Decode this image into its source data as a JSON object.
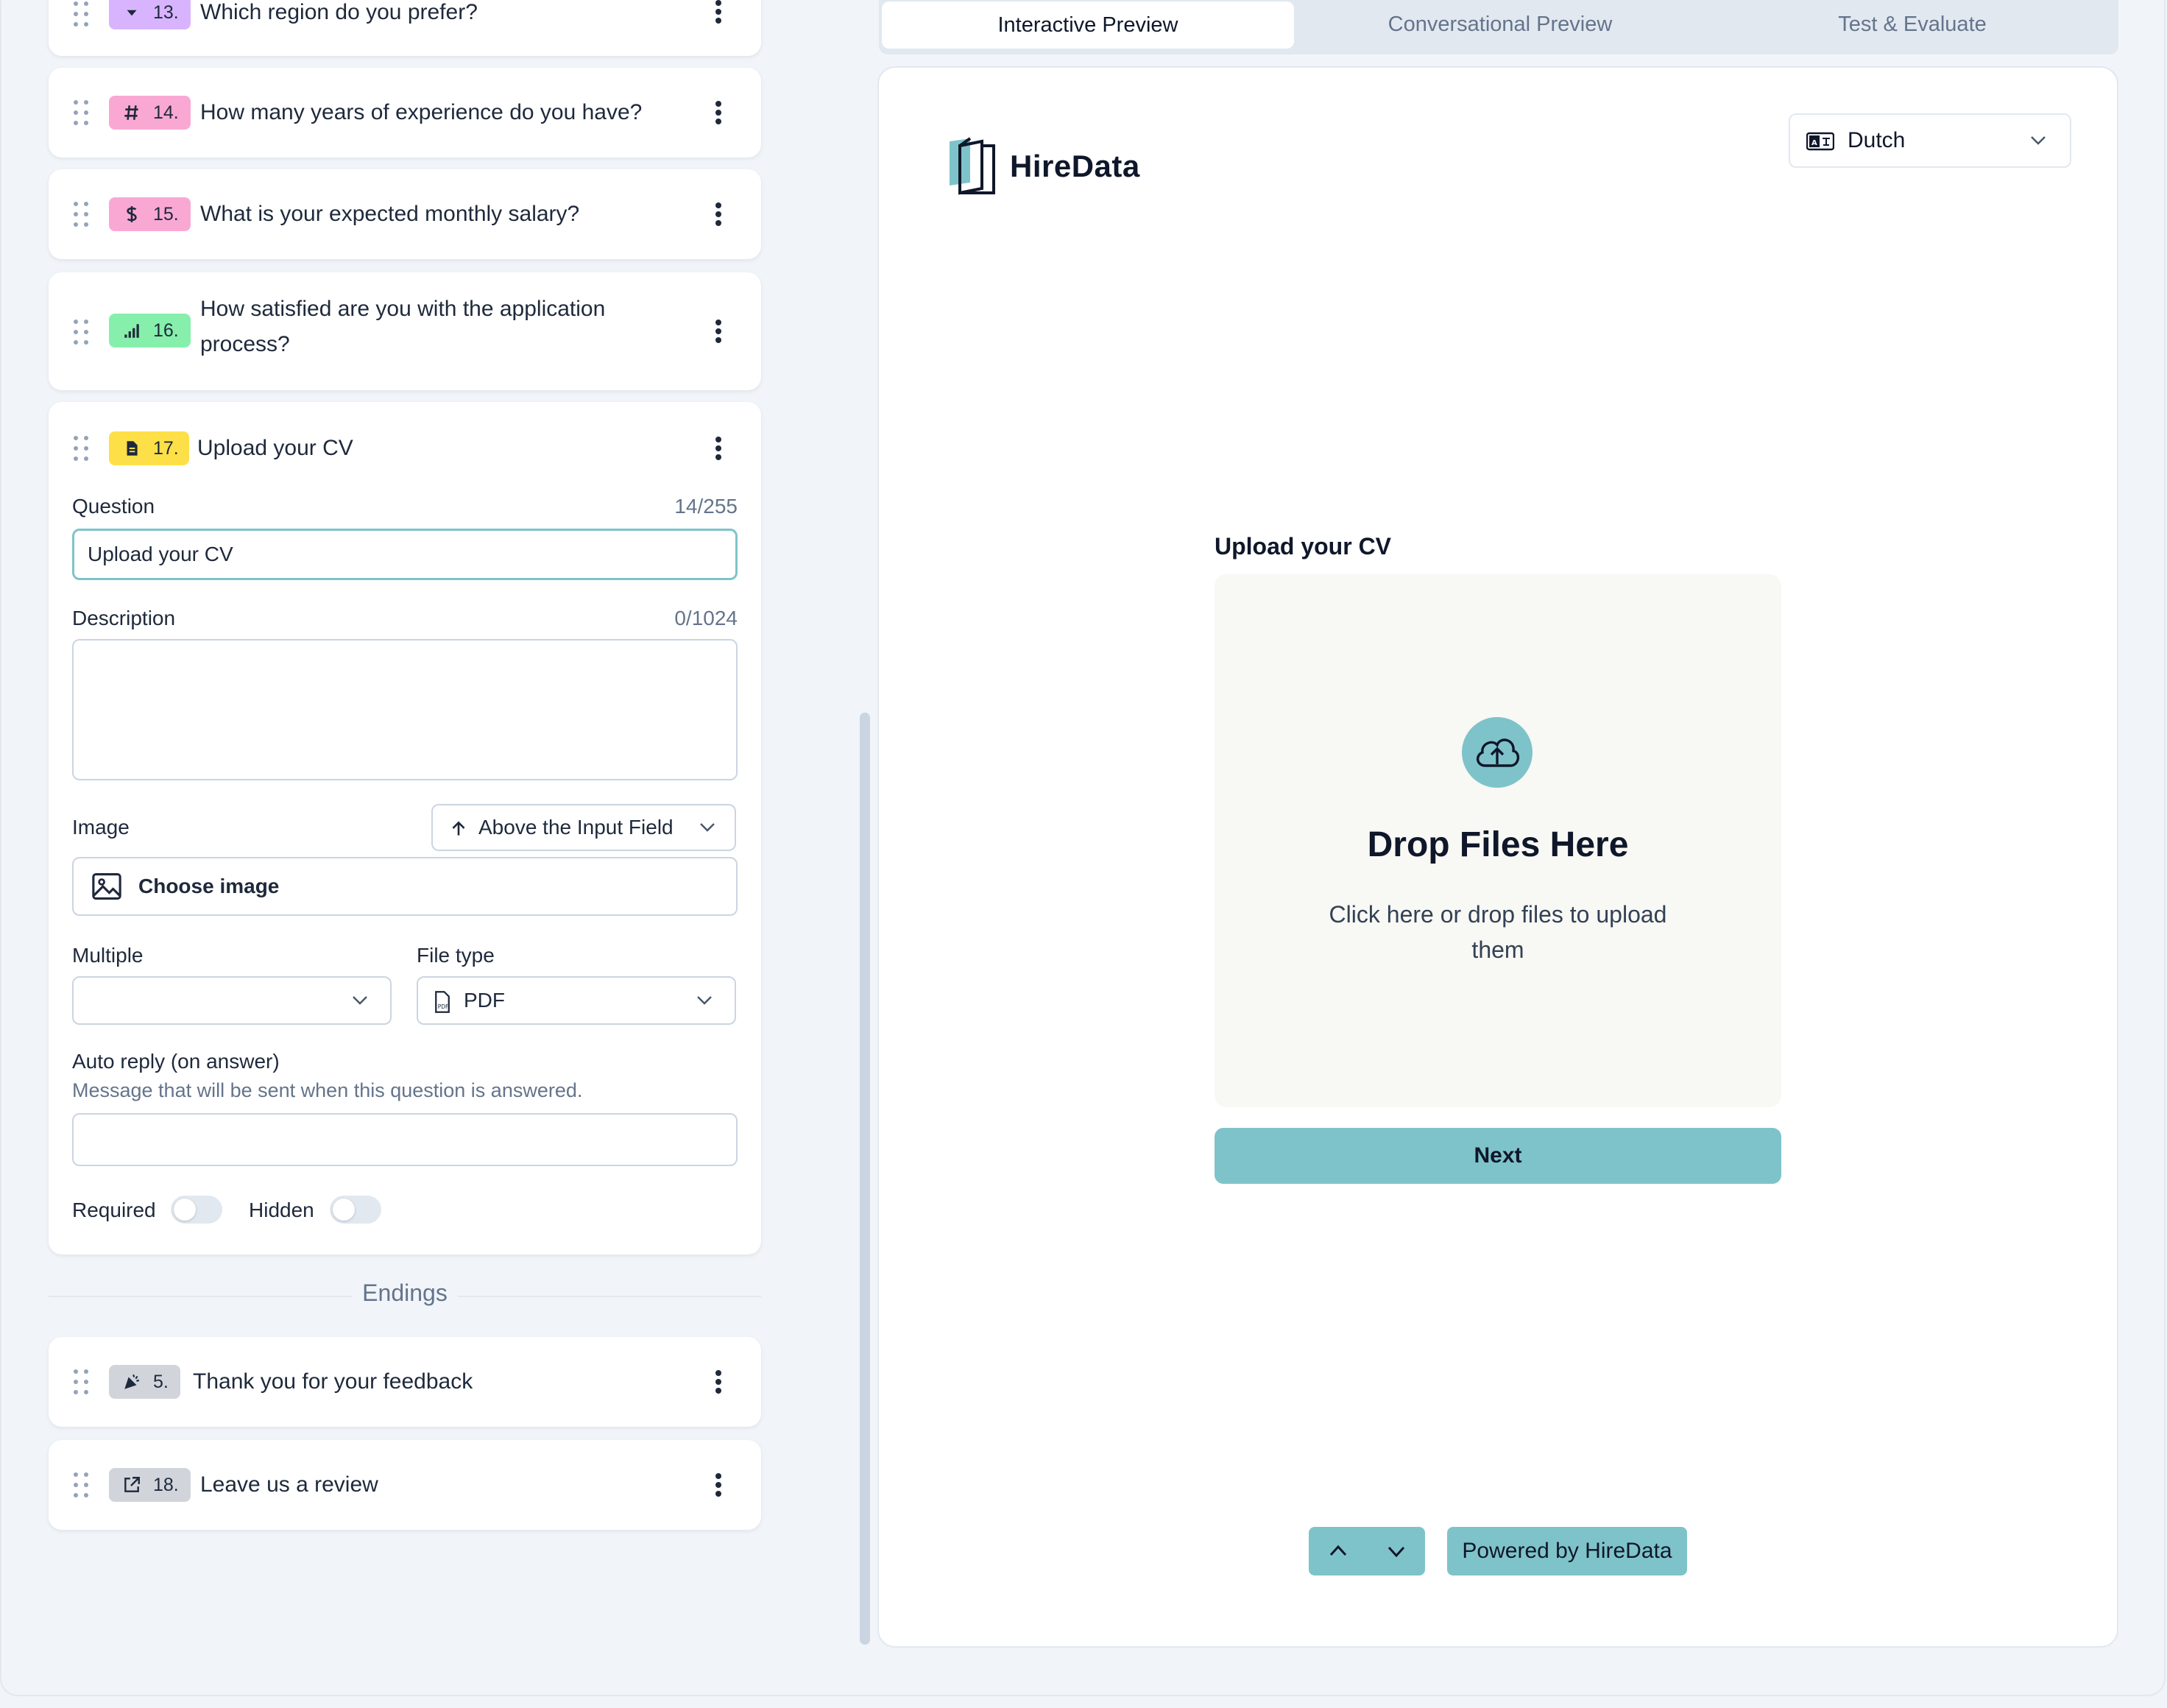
{
  "questions": [
    {
      "number": "13.",
      "title": "Which region do you prefer?",
      "icon": "dropdown-icon",
      "color": "#d8b4fe"
    },
    {
      "number": "14.",
      "title": "How many years of experience do you have?",
      "icon": "hash-icon",
      "color": "#f9a8d4"
    },
    {
      "number": "15.",
      "title": "What is your expected monthly salary?",
      "icon": "dollar-icon",
      "color": "#f9a8d4"
    },
    {
      "number": "16.",
      "title_line1": "How satisfied are you with the application",
      "title_line2": "process?",
      "icon": "rating-icon",
      "color": "#86efac"
    },
    {
      "number": "17.",
      "title": "Upload your CV",
      "icon": "file-icon",
      "color": "#fde047"
    }
  ],
  "editor": {
    "question_label": "Question",
    "question_counter": "14/255",
    "question_value": "Upload your CV",
    "description_label": "Description",
    "description_counter": "0/1024",
    "image_label": "Image",
    "image_position": "Above the Input Field",
    "choose_image": "Choose image",
    "multiple_label": "Multiple",
    "multiple_value": "",
    "file_type_label": "File type",
    "file_type_value": "PDF",
    "auto_reply_label": "Auto reply (on answer)",
    "auto_reply_hint": "Message that will be sent when this question is answered.",
    "required_label": "Required",
    "hidden_label": "Hidden",
    "required_on": false,
    "hidden_on": false
  },
  "endings": {
    "divider_label": "Endings",
    "items": [
      {
        "number": "5.",
        "title": "Thank you for your feedback",
        "icon": "celebrate-icon"
      },
      {
        "number": "18.",
        "title": "Leave us a review",
        "icon": "external-link-icon"
      }
    ]
  },
  "tabs": [
    {
      "label": "Interactive Preview",
      "active": true
    },
    {
      "label": "Conversational Preview",
      "active": false
    },
    {
      "label": "Test & Evaluate",
      "active": false
    }
  ],
  "preview": {
    "brand": "HireData",
    "language": "Dutch",
    "question": "Upload your CV",
    "drop_title": "Drop Files Here",
    "drop_sub": "Click here or drop files to upload them",
    "next_label": "Next",
    "powered_by": "Powered by HireData",
    "accent_color": "#7fc3ca"
  }
}
